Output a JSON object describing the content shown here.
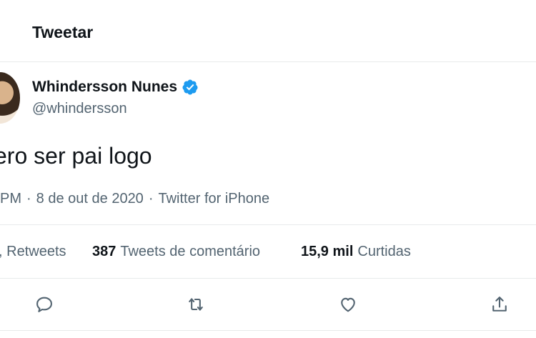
{
  "header": {
    "title": "Tweetar"
  },
  "tweet": {
    "display_name": "Whindersson Nunes",
    "handle": "@whindersson",
    "text": "ero ser pai logo",
    "time": "PM",
    "date": "8 de out de 2020",
    "source": "Twitter for iPhone",
    "separator": "·"
  },
  "stats": {
    "retweets_label": "Retweets",
    "retweets_glyph": ",",
    "quotes_count": "387",
    "quotes_label": "Tweets de comentário",
    "likes_count": "15,9 mil",
    "likes_label": "Curtidas"
  },
  "icons": {
    "verified": "verified-badge-icon",
    "reply": "reply-icon",
    "retweet": "retweet-icon",
    "like": "heart-icon",
    "share": "share-icon"
  },
  "colors": {
    "verified": "#1d9bf0",
    "secondary_text": "#536471",
    "border": "#e8eaeb"
  }
}
